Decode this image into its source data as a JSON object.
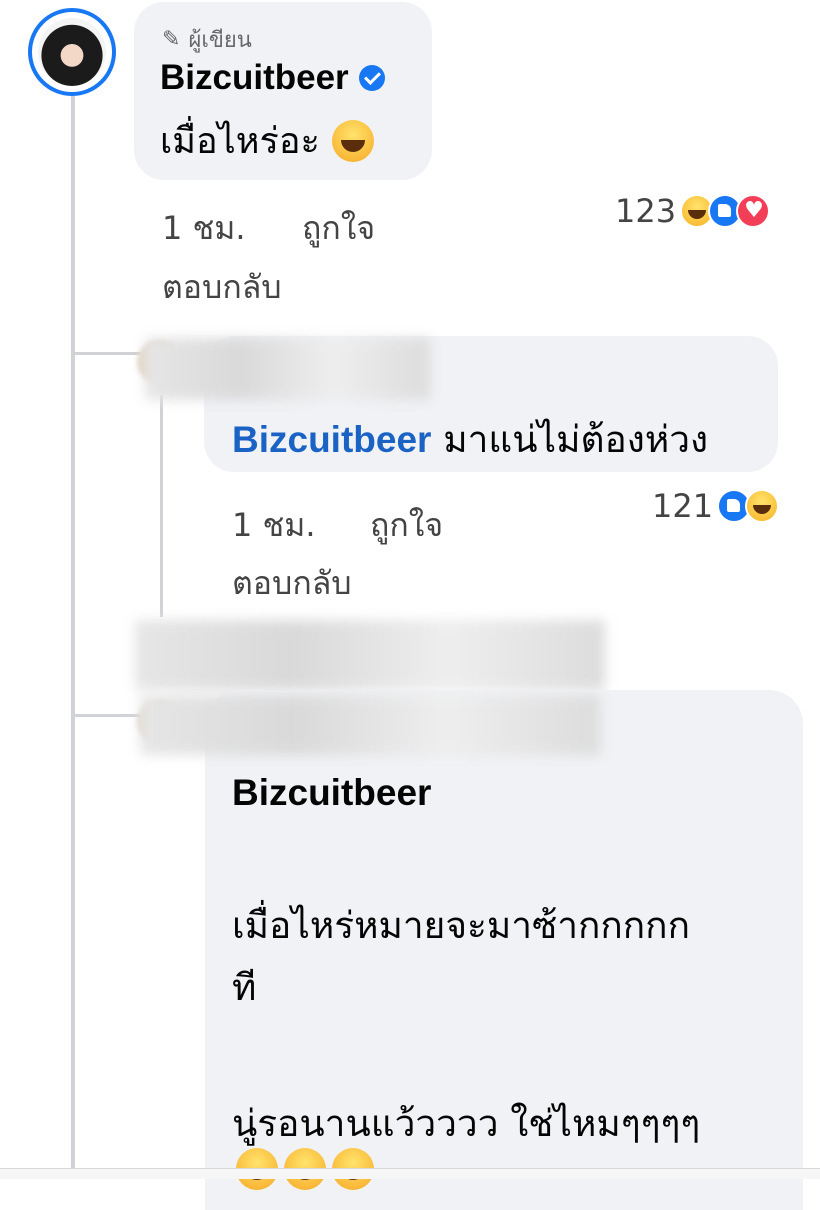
{
  "comment": {
    "author_label": "ผู้เขียน",
    "author": "Bizcuitbeer",
    "text": "เมื่อไหร่อะ",
    "time": "1 ชม.",
    "like_action": "ถูกใจ",
    "reply_action": "ตอบกลับ",
    "reaction_count": "123",
    "reactions": [
      "haha",
      "like",
      "love"
    ]
  },
  "reply1": {
    "mention": "Bizcuitbeer",
    "text": "มาแน่ไม่ต้องห่วง",
    "time": "1 ชม.",
    "like_action": "ถูกใจ",
    "reply_action": "ตอบกลับ",
    "reaction_count": "121",
    "reactions": [
      "like",
      "haha"
    ]
  },
  "reply2": {
    "mention": "Bizcuitbeer",
    "line1": "เมื่อไหร่หมายจะมาซ้ากกกกก",
    "line2": "ที",
    "line3": "นู่รอนานแว้วววว ใช่ไหมๆๆๆๆ"
  }
}
